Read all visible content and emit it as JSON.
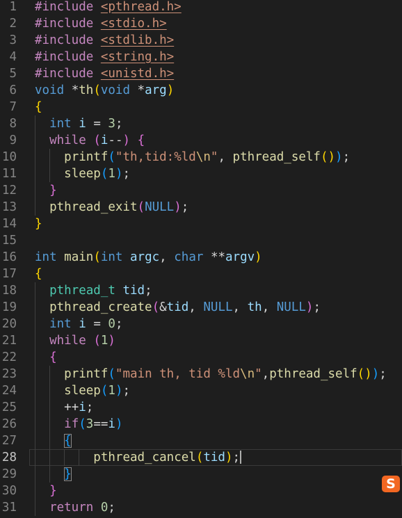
{
  "colors": {
    "background": "#1e1e1e",
    "keyword": "#569cd6",
    "control": "#c586c0",
    "function": "#dcdcaa",
    "string": "#ce9178",
    "number": "#b5cea8",
    "variable": "#9cdcfe",
    "type": "#4ec9b0",
    "line_number": "#858585"
  },
  "editor": {
    "current_line": 28,
    "lines": [
      {
        "n": "1",
        "tokens": [
          {
            "t": "#include ",
            "c": "pp"
          },
          {
            "t": "<pthread.h>",
            "c": "inc"
          }
        ]
      },
      {
        "n": "2",
        "tokens": [
          {
            "t": "#include ",
            "c": "pp"
          },
          {
            "t": "<stdio.h>",
            "c": "inc"
          }
        ]
      },
      {
        "n": "3",
        "tokens": [
          {
            "t": "#include ",
            "c": "pp"
          },
          {
            "t": "<stdlib.h>",
            "c": "inc"
          }
        ]
      },
      {
        "n": "4",
        "tokens": [
          {
            "t": "#include ",
            "c": "pp"
          },
          {
            "t": "<string.h>",
            "c": "inc"
          }
        ]
      },
      {
        "n": "5",
        "tokens": [
          {
            "t": "#include ",
            "c": "pp"
          },
          {
            "t": "<unistd.h>",
            "c": "inc"
          }
        ]
      },
      {
        "n": "6",
        "tokens": [
          {
            "t": "void",
            "c": "kw"
          },
          {
            "t": " *",
            "c": "pl"
          },
          {
            "t": "th",
            "c": "fn"
          },
          {
            "t": "(",
            "c": "b1"
          },
          {
            "t": "void",
            "c": "kw"
          },
          {
            "t": " *",
            "c": "pl"
          },
          {
            "t": "arg",
            "c": "var"
          },
          {
            "t": ")",
            "c": "b1"
          }
        ]
      },
      {
        "n": "7",
        "tokens": [
          {
            "t": "{",
            "c": "b1"
          }
        ]
      },
      {
        "n": "8",
        "tokens": [
          {
            "t": "  ",
            "c": "pl"
          },
          {
            "t": "int",
            "c": "kw"
          },
          {
            "t": " ",
            "c": "pl"
          },
          {
            "t": "i",
            "c": "var"
          },
          {
            "t": " = ",
            "c": "pl"
          },
          {
            "t": "3",
            "c": "num"
          },
          {
            "t": ";",
            "c": "pl"
          }
        ]
      },
      {
        "n": "9",
        "tokens": [
          {
            "t": "  ",
            "c": "pl"
          },
          {
            "t": "while",
            "c": "ctl"
          },
          {
            "t": " ",
            "c": "pl"
          },
          {
            "t": "(",
            "c": "b2"
          },
          {
            "t": "i",
            "c": "var"
          },
          {
            "t": "--",
            "c": "pl"
          },
          {
            "t": ")",
            "c": "b2"
          },
          {
            "t": " ",
            "c": "pl"
          },
          {
            "t": "{",
            "c": "b2"
          }
        ]
      },
      {
        "n": "10",
        "tokens": [
          {
            "t": "    ",
            "c": "pl"
          },
          {
            "t": "printf",
            "c": "fn"
          },
          {
            "t": "(",
            "c": "b3"
          },
          {
            "t": "\"th,tid:%ld",
            "c": "str"
          },
          {
            "t": "\\n",
            "c": "esc"
          },
          {
            "t": "\"",
            "c": "str"
          },
          {
            "t": ", ",
            "c": "pl"
          },
          {
            "t": "pthread_self",
            "c": "fn"
          },
          {
            "t": "()",
            "c": "b1"
          },
          {
            "t": ")",
            "c": "b3"
          },
          {
            "t": ";",
            "c": "pl"
          }
        ]
      },
      {
        "n": "11",
        "tokens": [
          {
            "t": "    ",
            "c": "pl"
          },
          {
            "t": "sleep",
            "c": "fn"
          },
          {
            "t": "(",
            "c": "b3"
          },
          {
            "t": "1",
            "c": "num"
          },
          {
            "t": ")",
            "c": "b3"
          },
          {
            "t": ";",
            "c": "pl"
          }
        ]
      },
      {
        "n": "12",
        "tokens": [
          {
            "t": "  ",
            "c": "pl"
          },
          {
            "t": "}",
            "c": "b2"
          }
        ]
      },
      {
        "n": "13",
        "tokens": [
          {
            "t": "  ",
            "c": "pl"
          },
          {
            "t": "pthread_exit",
            "c": "fn"
          },
          {
            "t": "(",
            "c": "b2"
          },
          {
            "t": "NULL",
            "c": "mac"
          },
          {
            "t": ")",
            "c": "b2"
          },
          {
            "t": ";",
            "c": "pl"
          }
        ]
      },
      {
        "n": "14",
        "tokens": [
          {
            "t": "}",
            "c": "b1"
          }
        ]
      },
      {
        "n": "15",
        "tokens": []
      },
      {
        "n": "16",
        "tokens": [
          {
            "t": "int",
            "c": "kw"
          },
          {
            "t": " ",
            "c": "pl"
          },
          {
            "t": "main",
            "c": "fn"
          },
          {
            "t": "(",
            "c": "b1"
          },
          {
            "t": "int",
            "c": "kw"
          },
          {
            "t": " ",
            "c": "pl"
          },
          {
            "t": "argc",
            "c": "var"
          },
          {
            "t": ", ",
            "c": "pl"
          },
          {
            "t": "char",
            "c": "kw"
          },
          {
            "t": " **",
            "c": "pl"
          },
          {
            "t": "argv",
            "c": "var"
          },
          {
            "t": ")",
            "c": "b1"
          }
        ]
      },
      {
        "n": "17",
        "tokens": [
          {
            "t": "{",
            "c": "b1"
          }
        ]
      },
      {
        "n": "18",
        "tokens": [
          {
            "t": "  ",
            "c": "pl"
          },
          {
            "t": "pthread_t",
            "c": "typ"
          },
          {
            "t": " ",
            "c": "pl"
          },
          {
            "t": "tid",
            "c": "var"
          },
          {
            "t": ";",
            "c": "pl"
          }
        ]
      },
      {
        "n": "19",
        "tokens": [
          {
            "t": "  ",
            "c": "pl"
          },
          {
            "t": "pthread_create",
            "c": "fn"
          },
          {
            "t": "(",
            "c": "b2"
          },
          {
            "t": "&",
            "c": "pl"
          },
          {
            "t": "tid",
            "c": "var"
          },
          {
            "t": ", ",
            "c": "pl"
          },
          {
            "t": "NULL",
            "c": "mac"
          },
          {
            "t": ", ",
            "c": "pl"
          },
          {
            "t": "th",
            "c": "var"
          },
          {
            "t": ", ",
            "c": "pl"
          },
          {
            "t": "NULL",
            "c": "mac"
          },
          {
            "t": ")",
            "c": "b2"
          },
          {
            "t": ";",
            "c": "pl"
          }
        ]
      },
      {
        "n": "20",
        "tokens": [
          {
            "t": "  ",
            "c": "pl"
          },
          {
            "t": "int",
            "c": "kw"
          },
          {
            "t": " ",
            "c": "pl"
          },
          {
            "t": "i",
            "c": "var"
          },
          {
            "t": " = ",
            "c": "pl"
          },
          {
            "t": "0",
            "c": "num"
          },
          {
            "t": ";",
            "c": "pl"
          }
        ]
      },
      {
        "n": "21",
        "tokens": [
          {
            "t": "  ",
            "c": "pl"
          },
          {
            "t": "while",
            "c": "ctl"
          },
          {
            "t": " ",
            "c": "pl"
          },
          {
            "t": "(",
            "c": "b2"
          },
          {
            "t": "1",
            "c": "num"
          },
          {
            "t": ")",
            "c": "b2"
          }
        ]
      },
      {
        "n": "22",
        "tokens": [
          {
            "t": "  ",
            "c": "pl"
          },
          {
            "t": "{",
            "c": "b2"
          }
        ]
      },
      {
        "n": "23",
        "tokens": [
          {
            "t": "    ",
            "c": "pl"
          },
          {
            "t": "printf",
            "c": "fn"
          },
          {
            "t": "(",
            "c": "b3"
          },
          {
            "t": "\"main th, tid %ld",
            "c": "str"
          },
          {
            "t": "\\n",
            "c": "esc"
          },
          {
            "t": "\"",
            "c": "str"
          },
          {
            "t": ",",
            "c": "pl"
          },
          {
            "t": "pthread_self",
            "c": "fn"
          },
          {
            "t": "()",
            "c": "b1"
          },
          {
            "t": ")",
            "c": "b3"
          },
          {
            "t": ";",
            "c": "pl"
          }
        ]
      },
      {
        "n": "24",
        "tokens": [
          {
            "t": "    ",
            "c": "pl"
          },
          {
            "t": "sleep",
            "c": "fn"
          },
          {
            "t": "(",
            "c": "b3"
          },
          {
            "t": "1",
            "c": "num"
          },
          {
            "t": ")",
            "c": "b3"
          },
          {
            "t": ";",
            "c": "pl"
          }
        ]
      },
      {
        "n": "25",
        "tokens": [
          {
            "t": "    ",
            "c": "pl"
          },
          {
            "t": "++",
            "c": "pl"
          },
          {
            "t": "i",
            "c": "var"
          },
          {
            "t": ";",
            "c": "pl"
          }
        ]
      },
      {
        "n": "26",
        "tokens": [
          {
            "t": "    ",
            "c": "pl"
          },
          {
            "t": "if",
            "c": "ctl"
          },
          {
            "t": "(",
            "c": "b3"
          },
          {
            "t": "3",
            "c": "num"
          },
          {
            "t": "==",
            "c": "pl"
          },
          {
            "t": "i",
            "c": "var"
          },
          {
            "t": ")",
            "c": "b3"
          }
        ]
      },
      {
        "n": "27",
        "tokens": [
          {
            "t": "    ",
            "c": "pl"
          },
          {
            "t": "{",
            "c": "b3",
            "box": true
          }
        ]
      },
      {
        "n": "28",
        "tokens": [
          {
            "t": "        ",
            "c": "pl"
          },
          {
            "t": "pthread_cancel",
            "c": "fn"
          },
          {
            "t": "(",
            "c": "b1"
          },
          {
            "t": "tid",
            "c": "var"
          },
          {
            "t": ")",
            "c": "b1"
          },
          {
            "t": ";",
            "c": "pl"
          }
        ]
      },
      {
        "n": "29",
        "tokens": [
          {
            "t": "    ",
            "c": "pl"
          },
          {
            "t": "}",
            "c": "b3",
            "box": true
          }
        ]
      },
      {
        "n": "30",
        "tokens": [
          {
            "t": "  ",
            "c": "pl"
          },
          {
            "t": "}",
            "c": "b2"
          }
        ]
      },
      {
        "n": "31",
        "tokens": [
          {
            "t": "  ",
            "c": "pl"
          },
          {
            "t": "return",
            "c": "ctl"
          },
          {
            "t": " ",
            "c": "pl"
          },
          {
            "t": "0",
            "c": "num"
          },
          {
            "t": ";",
            "c": "pl"
          }
        ]
      }
    ]
  },
  "overlay": {
    "ime_icon": "sogou-ime-icon",
    "ime_glyph": "S"
  }
}
